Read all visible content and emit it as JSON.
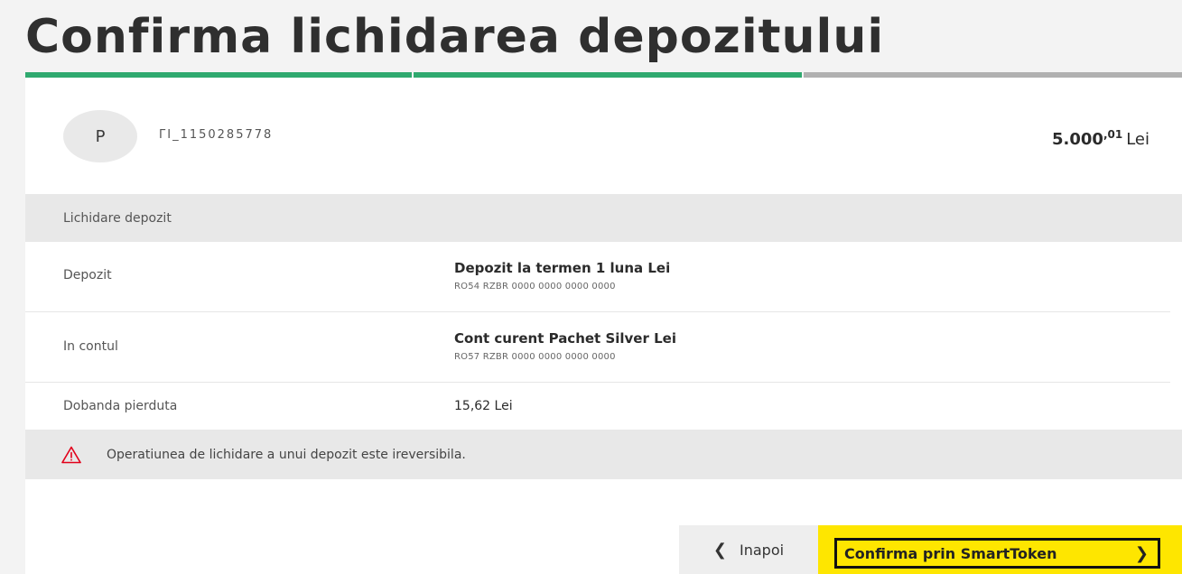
{
  "page": {
    "title": "Confirma lichidarea depozitului"
  },
  "header": {
    "avatar_letter": "P",
    "account_name": "ΓΙ_1150285778",
    "amount_int": "5.000",
    "amount_dec": ",01",
    "currency": "Lei"
  },
  "section": {
    "label": "Lichidare depozit"
  },
  "rows": [
    {
      "label": "Depozit",
      "title": "Depozit la termen 1 luna Lei",
      "sub": "RO54 RZBR 0000 0000 0000 0000"
    },
    {
      "label": "In contul",
      "title": "Cont curent Pachet Silver Lei",
      "sub": "RO57 RZBR 0000 0000 0000 0000"
    },
    {
      "label": "Dobanda pierduta",
      "value": "15,62 Lei"
    }
  ],
  "warning": {
    "icon": "warning-triangle-icon",
    "text": "Operatiunea de lichidare a unui depozit este ireversibila."
  },
  "buttons": {
    "back_label": "Inapoi",
    "back_icon": "chevron-left-icon",
    "confirm_label": "Confirma prin SmartToken",
    "confirm_icon": "chevron-right-icon"
  },
  "colors": {
    "progress_active": "#2fa96f",
    "progress_inactive": "#b0b0b0",
    "accent": "#fee600",
    "warning": "#e2001a"
  }
}
